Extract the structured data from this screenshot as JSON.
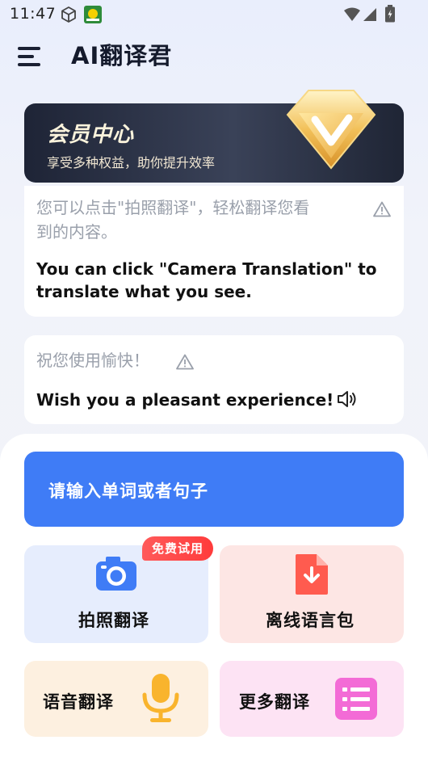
{
  "status_bar": {
    "time": "11:47"
  },
  "header": {
    "title": "AI翻译君"
  },
  "vip": {
    "title": "会员中心",
    "subtitle": "享受多种权益，助你提升效率"
  },
  "messages": [
    {
      "zh": "您可以点击\"拍照翻译\"，轻松翻译您看到的内容。",
      "zh_line1": "您可以点击\"拍照翻译\"，轻松翻译您看",
      "zh_line2": "到的内容。",
      "en_line1": "You can click \"Camera Translation\" to",
      "en_line2": "translate what you see."
    },
    {
      "zh": "祝您使用愉快！",
      "en": "Wish you a pleasant experience!"
    }
  ],
  "input": {
    "placeholder": "请输入单词或者句子"
  },
  "tiles": {
    "camera": {
      "label": "拍照翻译",
      "badge": "免费试用",
      "icon": "camera-icon"
    },
    "offline": {
      "label": "离线语言包",
      "icon": "download-file-icon"
    },
    "voice": {
      "label": "语音翻译",
      "icon": "microphone-icon"
    },
    "more": {
      "label": "更多翻译",
      "icon": "list-icon"
    }
  },
  "colors": {
    "accent": "#3f7cf6",
    "badge": "#ff4a4a",
    "vip_bg": "#2a3044"
  }
}
